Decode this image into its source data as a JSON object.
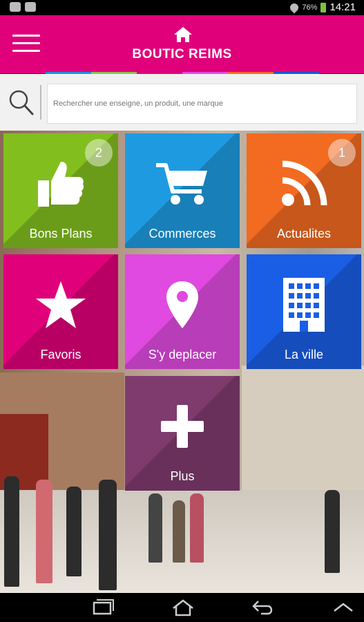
{
  "status": {
    "battery": "76%",
    "time": "14:21"
  },
  "header": {
    "title": "BOUTIC REIMS",
    "color": "#e0007a",
    "strip_colors": [
      "#1e90e0",
      "#8bc34a",
      "#e0007a",
      "#e04ae8",
      "#f36a21",
      "#1259d9"
    ]
  },
  "search": {
    "placeholder": "Rechercher une enseigne, un produit, une marque",
    "value": ""
  },
  "tiles": [
    {
      "label": "Bons Plans",
      "badge": "2",
      "color": "#82be1e",
      "icon": "thumbs-up-icon"
    },
    {
      "label": "Commerces",
      "badge": "",
      "color": "#1e9be0",
      "icon": "shopping-cart-icon"
    },
    {
      "label": "Actualites",
      "badge": "1",
      "color": "#f36a21",
      "icon": "rss-icon"
    },
    {
      "label": "Favoris",
      "badge": "",
      "color": "#e0007a",
      "icon": "star-icon"
    },
    {
      "label": "S'y deplacer",
      "badge": "",
      "color": "#e04ae0",
      "icon": "map-pin-icon"
    },
    {
      "label": "La ville",
      "badge": "",
      "color": "#1a5ee6",
      "icon": "building-icon"
    },
    {
      "label": "Plus",
      "badge": "",
      "color": "#7f3b6e",
      "icon": "plus-icon"
    }
  ]
}
